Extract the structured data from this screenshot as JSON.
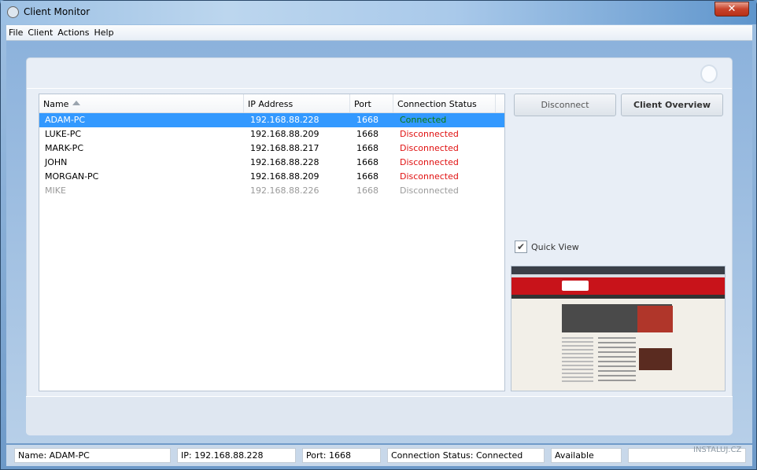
{
  "window": {
    "title": "Client Monitor",
    "close_label": "✕"
  },
  "menu": [
    "File",
    "Client",
    "Actions",
    "Help"
  ],
  "table": {
    "columns": [
      "Name",
      "IP Address",
      "Port",
      "Connection Status"
    ],
    "sort_column": "Name",
    "sort_direction": "ascending",
    "rows": [
      {
        "name": "ADAM-PC",
        "ip": "192.168.88.228",
        "port": "1668",
        "status": "Connected",
        "selected": true
      },
      {
        "name": "LUKE-PC",
        "ip": "192.168.88.209",
        "port": "1668",
        "status": "Disconnected"
      },
      {
        "name": "MARK-PC",
        "ip": "192.168.88.217",
        "port": "1668",
        "status": "Disconnected"
      },
      {
        "name": "JOHN",
        "ip": "192.168.88.228",
        "port": "1668",
        "status": "Disconnected"
      },
      {
        "name": "MORGAN-PC",
        "ip": "192.168.88.209",
        "port": "1668",
        "status": "Disconnected"
      },
      {
        "name": "MIKE",
        "ip": "192.168.88.226",
        "port": "1668",
        "status": "Disconnected",
        "dimmed": true
      }
    ]
  },
  "buttons": {
    "disconnect": "Disconnect",
    "overview": "Client Overview"
  },
  "quick_view": {
    "label": "Quick View",
    "checked": true
  },
  "statusbar": {
    "name": "Name: ADAM-PC",
    "ip": "IP: 192.168.88.228",
    "port": "Port: 1668",
    "status": "Connection Status: Connected",
    "availability": "Available"
  },
  "watermark": "INSTALUJ.CZ",
  "colors": {
    "connected": "#1e8f1e",
    "disconnected": "#e01010",
    "selection": "#3399ff",
    "dimmed": "#9a9a9a"
  }
}
